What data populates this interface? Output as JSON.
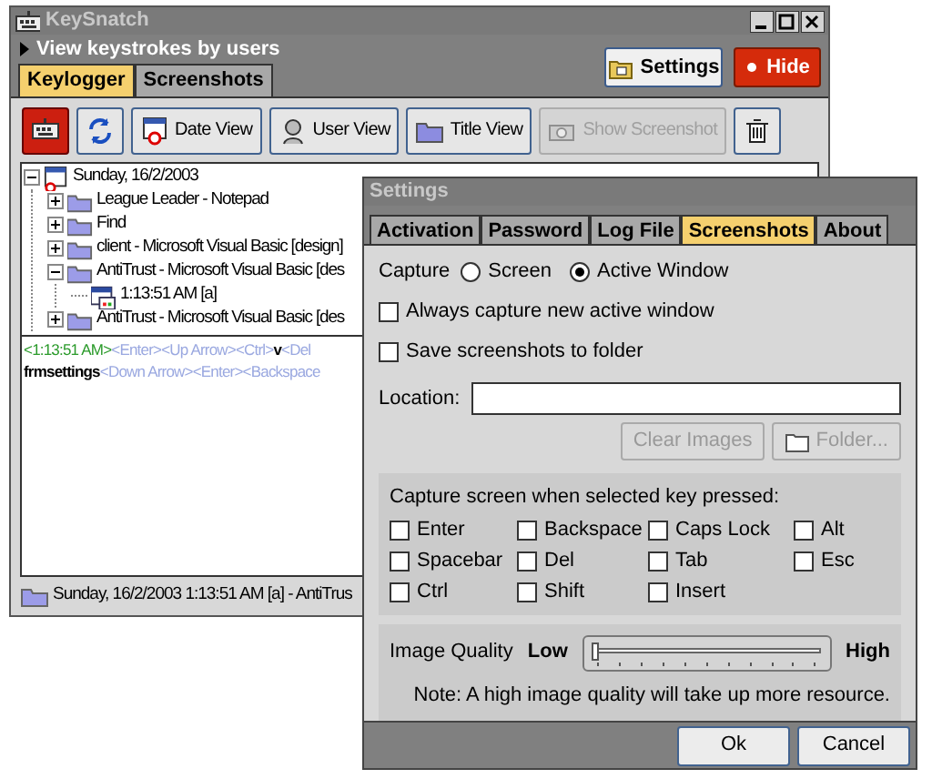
{
  "main_window": {
    "title": "KeySnatch",
    "header": "View keystrokes by users",
    "tabs": [
      {
        "label": "Keylogger",
        "selected": true
      },
      {
        "label": "Screenshots",
        "selected": false
      }
    ],
    "header_buttons": [
      {
        "label": "Settings",
        "kind": "settings"
      },
      {
        "label": "Hide",
        "kind": "hide"
      }
    ],
    "toolbar": [
      {
        "kind": "keyboard",
        "active": true,
        "disabled": false
      },
      {
        "kind": "refresh",
        "active": false,
        "disabled": false
      },
      {
        "kind": "date",
        "label": "Date View",
        "active": false,
        "disabled": false
      },
      {
        "kind": "user",
        "label": "User View",
        "active": false,
        "disabled": false
      },
      {
        "kind": "title",
        "label": "Title View",
        "active": false,
        "disabled": false
      },
      {
        "kind": "camera",
        "label": "Show Screenshot",
        "active": false,
        "disabled": true
      },
      {
        "kind": "trash",
        "active": false,
        "disabled": false
      }
    ],
    "tree": [
      {
        "label": "Sunday, 16/2/2003",
        "kind": "date",
        "expanded": true,
        "children": [
          {
            "label": "League Leader - Notepad",
            "kind": "folder",
            "expanded": false
          },
          {
            "label": "Find",
            "kind": "folder",
            "expanded": false
          },
          {
            "label": "client - Microsoft Visual Basic [design]",
            "kind": "folder",
            "expanded": false
          },
          {
            "label": "AntiTrust - Microsoft Visual Basic [des",
            "kind": "folder",
            "expanded": true,
            "children": [
              {
                "label": "1:13:51 AM [a]",
                "kind": "window"
              }
            ]
          },
          {
            "label": "AntiTrust - Microsoft Visual Basic [des",
            "kind": "folder",
            "expanded": false
          }
        ]
      }
    ],
    "log": [
      [
        {
          "kind": "time",
          "text": "<1:13:51 AM>"
        },
        {
          "kind": "key",
          "text": "<Enter><Up Arrow><Ctrl>"
        },
        {
          "kind": "typed",
          "text": "v"
        },
        {
          "kind": "key",
          "text": "<Del"
        }
      ],
      [
        {
          "kind": "typed",
          "text": "frmsettings"
        },
        {
          "kind": "key",
          "text": "<Down Arrow><Enter><Backspace"
        }
      ]
    ],
    "status": "Sunday, 16/2/2003 1:13:51 AM [a] - AntiTrus"
  },
  "settings": {
    "title": "Settings",
    "tabs": [
      {
        "label": "Activation",
        "selected": false
      },
      {
        "label": "Password",
        "selected": false
      },
      {
        "label": "Log File",
        "selected": false
      },
      {
        "label": "Screenshots",
        "selected": true
      },
      {
        "label": "About",
        "selected": false
      }
    ],
    "capture": {
      "label": "Capture",
      "options": [
        {
          "label": "Screen",
          "selected": false
        },
        {
          "label": "Active Window",
          "selected": true
        }
      ]
    },
    "options": [
      {
        "label": "Always capture new active window",
        "checked": false
      },
      {
        "label": "Save screenshots to folder",
        "checked": false
      }
    ],
    "location": {
      "label": "Location:"
    },
    "location_buttons": [
      {
        "label": "Clear Images",
        "kind": "clear",
        "disabled": true
      },
      {
        "label": "Folder...",
        "kind": "folder",
        "disabled": true
      }
    ],
    "keys_heading": "Capture screen when selected key pressed:",
    "keys": [
      {
        "label": "Enter",
        "checked": false
      },
      {
        "label": "Backspace",
        "checked": false
      },
      {
        "label": "Caps Lock",
        "checked": false
      },
      {
        "label": "Alt",
        "checked": false
      },
      {
        "label": "Spacebar",
        "checked": false
      },
      {
        "label": "Del",
        "checked": false
      },
      {
        "label": "Tab",
        "checked": false
      },
      {
        "label": "Esc",
        "checked": false
      },
      {
        "label": "Ctrl",
        "checked": false
      },
      {
        "label": "Shift",
        "checked": false
      },
      {
        "label": "Insert",
        "checked": false
      }
    ],
    "quality": {
      "label": "Image Quality",
      "low": "Low",
      "high": "High",
      "level": 0,
      "note": "Note: A high image quality will take up more resource."
    },
    "buttons": [
      "Ok",
      "Cancel"
    ]
  }
}
